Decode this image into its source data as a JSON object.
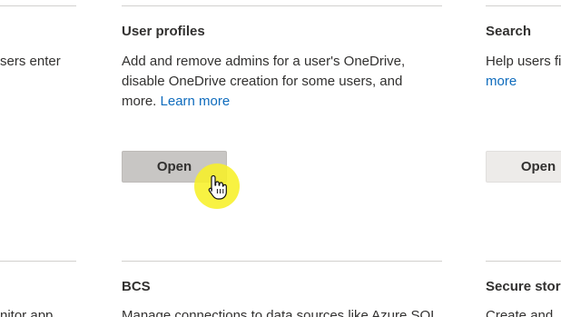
{
  "cards": {
    "left_top": {
      "desc_fragment": "sers enter"
    },
    "user_profiles": {
      "title": "User profiles",
      "desc_line1": "Add and remove admins for a user's OneDrive,",
      "desc_line2": "disable OneDrive creation for some users, and",
      "desc_line3_prefix": "more. ",
      "learn_more": "Learn more",
      "button": "Open"
    },
    "search": {
      "title": "Search",
      "desc_fragment": "Help users fi",
      "learn_more_fragment": "more",
      "button": "Open"
    },
    "left_bottom": {
      "desc_fragment": "nitor app"
    },
    "bcs": {
      "title": "BCS",
      "desc_fragment": "Manage connections to data sources like Azure SQL"
    },
    "secure_store": {
      "title": "Secure store",
      "desc_fragment": "Create and"
    }
  },
  "cursor": {
    "icon": "hand-pointer-icon",
    "highlight_color": "#f7f028"
  },
  "colors": {
    "link": "#0f6cbd",
    "divider": "#d2d0ce",
    "button_bg": "#e1dfdd",
    "text": "#323130"
  }
}
